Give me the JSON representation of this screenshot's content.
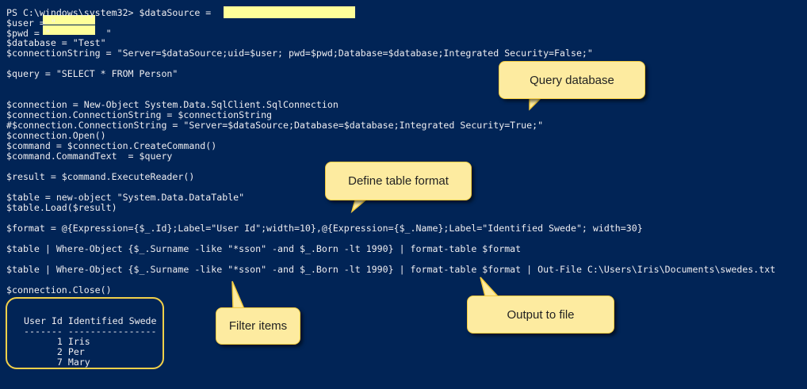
{
  "terminal": {
    "prompt": "PS C:\\windows\\system32> ",
    "lines": [
      "PS C:\\windows\\system32> $dataSource = ",
      "$user = \"",
      "$pwd = \"          \"",
      "$database = \"Test\"",
      "$connectionString = \"Server=$dataSource;uid=$user; pwd=$pwd;Database=$database;Integrated Security=False;\"",
      "$query = \"SELECT * FROM Person\"",
      "$connection = New-Object System.Data.SqlClient.SqlConnection",
      "$connection.ConnectionString = $connectionString",
      "#$connection.ConnectionString = \"Server=$dataSource;Database=$database;Integrated Security=True;\"",
      "$connection.Open()",
      "$command = $connection.CreateCommand()",
      "$command.CommandText  = $query",
      "$result = $command.ExecuteReader()",
      "$table = new-object \"System.Data.DataTable\"",
      "$table.Load($result)",
      "$format = @{Expression={$_.Id};Label=\"User Id\";width=10},@{Expression={$_.Name};Label=\"Identified Swede\"; width=30}",
      "$table | Where-Object {$_.Surname -like \"*sson\" -and $_.Born -lt 1990} | format-table $format",
      "$table | Where-Object {$_.Surname -like \"*sson\" -and $_.Born -lt 1990} | format-table $format | Out-File C:\\Users\\Iris\\Documents\\swedes.txt",
      "$connection.Close()"
    ]
  },
  "output": {
    "header": "User Id Identified Swede",
    "separator": "------- ----------------",
    "rows": [
      "      1 Iris",
      "      2 Per",
      "      7 Mary"
    ]
  },
  "callouts": {
    "query": "Query database",
    "format": "Define table format",
    "filter": "Filter items",
    "output": "Output to file"
  },
  "colors": {
    "background": "#012456",
    "text": "#eeedf0",
    "highlight": "#ffff99",
    "callout_fill": "#fdeba0",
    "callout_border": "#f4cc3f"
  }
}
